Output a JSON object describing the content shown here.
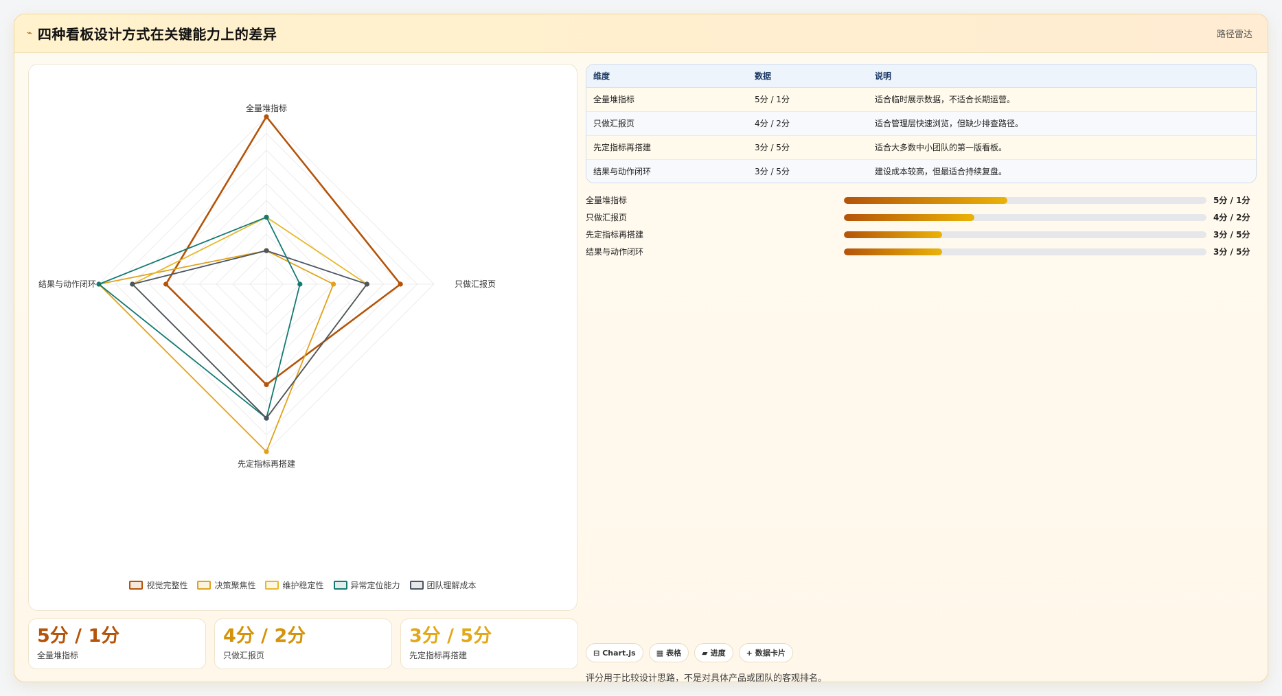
{
  "header": {
    "icon": "trend-icon",
    "title": "四种看板设计方式在关键能力上的差异",
    "tag": "路径雷达"
  },
  "chart_data": {
    "type": "radar",
    "axes": [
      "全量堆指标",
      "只做汇报页",
      "先定指标再搭建",
      "结果与动作闭环"
    ],
    "range": [
      0,
      5
    ],
    "grid": true,
    "legend_position": "bottom",
    "series": [
      {
        "name": "视觉完整性",
        "color": "#b45309",
        "values": [
          5,
          4,
          3,
          3
        ]
      },
      {
        "name": "决策聚焦性",
        "color": "#e0a21b",
        "values": [
          1,
          2,
          5,
          5
        ]
      },
      {
        "name": "维护稳定性",
        "color": "#e6b829",
        "values": [
          2,
          3,
          4,
          4
        ]
      },
      {
        "name": "异常定位能力",
        "color": "#137a72",
        "values": [
          2,
          1,
          4,
          5
        ]
      },
      {
        "name": "团队理解成本",
        "color": "#4b5563",
        "values": [
          1,
          3,
          4,
          4
        ]
      }
    ]
  },
  "table": {
    "headers": [
      "维度",
      "数据",
      "说明"
    ],
    "rows": [
      {
        "dim": "全量堆指标",
        "data": "5分 / 1分",
        "note": "适合临时展示数据，不适合长期运营。"
      },
      {
        "dim": "只做汇报页",
        "data": "4分 / 2分",
        "note": "适合管理层快速浏览，但缺少排查路径。"
      },
      {
        "dim": "先定指标再搭建",
        "data": "3分 / 5分",
        "note": "适合大多数中小团队的第一版看板。"
      },
      {
        "dim": "结果与动作闭环",
        "data": "3分 / 5分",
        "note": "建设成本较高，但最适合持续复盘。"
      }
    ]
  },
  "progress": [
    {
      "label": "全量堆指标",
      "value": "5分 / 1分",
      "fraction": 0.45
    },
    {
      "label": "只做汇报页",
      "value": "4分 / 2分",
      "fraction": 0.36
    },
    {
      "label": "先定指标再搭建",
      "value": "3分 / 5分",
      "fraction": 0.27
    },
    {
      "label": "结果与动作闭环",
      "value": "3分 / 5分",
      "fraction": 0.27
    }
  ],
  "kpis": [
    {
      "value": "5分 / 1分",
      "label": "全量堆指标",
      "color": "#b45309"
    },
    {
      "value": "4分 / 2分",
      "label": "只做汇报页",
      "color": "#d4930a"
    },
    {
      "value": "3分 / 5分",
      "label": "先定指标再搭建",
      "color": "#e3a81a"
    }
  ],
  "chips": [
    {
      "icon": "table-icon",
      "label": "Chart.js"
    },
    {
      "icon": "grid-icon",
      "label": "表格"
    },
    {
      "icon": "progress-icon",
      "label": "进度"
    },
    {
      "icon": "plus-icon",
      "label": "数据卡片"
    }
  ],
  "footnote": "评分用于比较设计思路，不是对具体产品或团队的客观排名。"
}
